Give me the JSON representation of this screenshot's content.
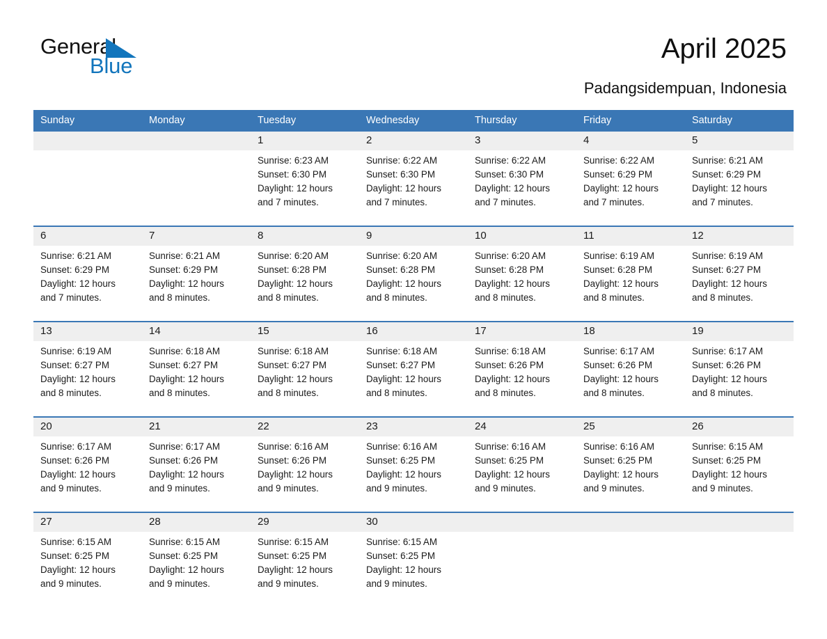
{
  "brand": {
    "name_part1": "General",
    "name_part2": "Blue",
    "accent_color": "#1275bc"
  },
  "header": {
    "title": "April 2025",
    "location": "Padangsidempuan, Indonesia"
  },
  "calendar": {
    "header_background": "#3a77b5",
    "daynum_background": "#efefef",
    "weekday_headers": [
      "Sunday",
      "Monday",
      "Tuesday",
      "Wednesday",
      "Thursday",
      "Friday",
      "Saturday"
    ],
    "weeks": [
      [
        {
          "day": "",
          "sunrise": "",
          "sunset": "",
          "daylight_line1": "",
          "daylight_line2": "",
          "empty": true
        },
        {
          "day": "",
          "sunrise": "",
          "sunset": "",
          "daylight_line1": "",
          "daylight_line2": "",
          "empty": true
        },
        {
          "day": "1",
          "sunrise": "Sunrise: 6:23 AM",
          "sunset": "Sunset: 6:30 PM",
          "daylight_line1": "Daylight: 12 hours",
          "daylight_line2": "and 7 minutes."
        },
        {
          "day": "2",
          "sunrise": "Sunrise: 6:22 AM",
          "sunset": "Sunset: 6:30 PM",
          "daylight_line1": "Daylight: 12 hours",
          "daylight_line2": "and 7 minutes."
        },
        {
          "day": "3",
          "sunrise": "Sunrise: 6:22 AM",
          "sunset": "Sunset: 6:30 PM",
          "daylight_line1": "Daylight: 12 hours",
          "daylight_line2": "and 7 minutes."
        },
        {
          "day": "4",
          "sunrise": "Sunrise: 6:22 AM",
          "sunset": "Sunset: 6:29 PM",
          "daylight_line1": "Daylight: 12 hours",
          "daylight_line2": "and 7 minutes."
        },
        {
          "day": "5",
          "sunrise": "Sunrise: 6:21 AM",
          "sunset": "Sunset: 6:29 PM",
          "daylight_line1": "Daylight: 12 hours",
          "daylight_line2": "and 7 minutes."
        }
      ],
      [
        {
          "day": "6",
          "sunrise": "Sunrise: 6:21 AM",
          "sunset": "Sunset: 6:29 PM",
          "daylight_line1": "Daylight: 12 hours",
          "daylight_line2": "and 7 minutes."
        },
        {
          "day": "7",
          "sunrise": "Sunrise: 6:21 AM",
          "sunset": "Sunset: 6:29 PM",
          "daylight_line1": "Daylight: 12 hours",
          "daylight_line2": "and 8 minutes."
        },
        {
          "day": "8",
          "sunrise": "Sunrise: 6:20 AM",
          "sunset": "Sunset: 6:28 PM",
          "daylight_line1": "Daylight: 12 hours",
          "daylight_line2": "and 8 minutes."
        },
        {
          "day": "9",
          "sunrise": "Sunrise: 6:20 AM",
          "sunset": "Sunset: 6:28 PM",
          "daylight_line1": "Daylight: 12 hours",
          "daylight_line2": "and 8 minutes."
        },
        {
          "day": "10",
          "sunrise": "Sunrise: 6:20 AM",
          "sunset": "Sunset: 6:28 PM",
          "daylight_line1": "Daylight: 12 hours",
          "daylight_line2": "and 8 minutes."
        },
        {
          "day": "11",
          "sunrise": "Sunrise: 6:19 AM",
          "sunset": "Sunset: 6:28 PM",
          "daylight_line1": "Daylight: 12 hours",
          "daylight_line2": "and 8 minutes."
        },
        {
          "day": "12",
          "sunrise": "Sunrise: 6:19 AM",
          "sunset": "Sunset: 6:27 PM",
          "daylight_line1": "Daylight: 12 hours",
          "daylight_line2": "and 8 minutes."
        }
      ],
      [
        {
          "day": "13",
          "sunrise": "Sunrise: 6:19 AM",
          "sunset": "Sunset: 6:27 PM",
          "daylight_line1": "Daylight: 12 hours",
          "daylight_line2": "and 8 minutes."
        },
        {
          "day": "14",
          "sunrise": "Sunrise: 6:18 AM",
          "sunset": "Sunset: 6:27 PM",
          "daylight_line1": "Daylight: 12 hours",
          "daylight_line2": "and 8 minutes."
        },
        {
          "day": "15",
          "sunrise": "Sunrise: 6:18 AM",
          "sunset": "Sunset: 6:27 PM",
          "daylight_line1": "Daylight: 12 hours",
          "daylight_line2": "and 8 minutes."
        },
        {
          "day": "16",
          "sunrise": "Sunrise: 6:18 AM",
          "sunset": "Sunset: 6:27 PM",
          "daylight_line1": "Daylight: 12 hours",
          "daylight_line2": "and 8 minutes."
        },
        {
          "day": "17",
          "sunrise": "Sunrise: 6:18 AM",
          "sunset": "Sunset: 6:26 PM",
          "daylight_line1": "Daylight: 12 hours",
          "daylight_line2": "and 8 minutes."
        },
        {
          "day": "18",
          "sunrise": "Sunrise: 6:17 AM",
          "sunset": "Sunset: 6:26 PM",
          "daylight_line1": "Daylight: 12 hours",
          "daylight_line2": "and 8 minutes."
        },
        {
          "day": "19",
          "sunrise": "Sunrise: 6:17 AM",
          "sunset": "Sunset: 6:26 PM",
          "daylight_line1": "Daylight: 12 hours",
          "daylight_line2": "and 8 minutes."
        }
      ],
      [
        {
          "day": "20",
          "sunrise": "Sunrise: 6:17 AM",
          "sunset": "Sunset: 6:26 PM",
          "daylight_line1": "Daylight: 12 hours",
          "daylight_line2": "and 9 minutes."
        },
        {
          "day": "21",
          "sunrise": "Sunrise: 6:17 AM",
          "sunset": "Sunset: 6:26 PM",
          "daylight_line1": "Daylight: 12 hours",
          "daylight_line2": "and 9 minutes."
        },
        {
          "day": "22",
          "sunrise": "Sunrise: 6:16 AM",
          "sunset": "Sunset: 6:26 PM",
          "daylight_line1": "Daylight: 12 hours",
          "daylight_line2": "and 9 minutes."
        },
        {
          "day": "23",
          "sunrise": "Sunrise: 6:16 AM",
          "sunset": "Sunset: 6:25 PM",
          "daylight_line1": "Daylight: 12 hours",
          "daylight_line2": "and 9 minutes."
        },
        {
          "day": "24",
          "sunrise": "Sunrise: 6:16 AM",
          "sunset": "Sunset: 6:25 PM",
          "daylight_line1": "Daylight: 12 hours",
          "daylight_line2": "and 9 minutes."
        },
        {
          "day": "25",
          "sunrise": "Sunrise: 6:16 AM",
          "sunset": "Sunset: 6:25 PM",
          "daylight_line1": "Daylight: 12 hours",
          "daylight_line2": "and 9 minutes."
        },
        {
          "day": "26",
          "sunrise": "Sunrise: 6:15 AM",
          "sunset": "Sunset: 6:25 PM",
          "daylight_line1": "Daylight: 12 hours",
          "daylight_line2": "and 9 minutes."
        }
      ],
      [
        {
          "day": "27",
          "sunrise": "Sunrise: 6:15 AM",
          "sunset": "Sunset: 6:25 PM",
          "daylight_line1": "Daylight: 12 hours",
          "daylight_line2": "and 9 minutes."
        },
        {
          "day": "28",
          "sunrise": "Sunrise: 6:15 AM",
          "sunset": "Sunset: 6:25 PM",
          "daylight_line1": "Daylight: 12 hours",
          "daylight_line2": "and 9 minutes."
        },
        {
          "day": "29",
          "sunrise": "Sunrise: 6:15 AM",
          "sunset": "Sunset: 6:25 PM",
          "daylight_line1": "Daylight: 12 hours",
          "daylight_line2": "and 9 minutes."
        },
        {
          "day": "30",
          "sunrise": "Sunrise: 6:15 AM",
          "sunset": "Sunset: 6:25 PM",
          "daylight_line1": "Daylight: 12 hours",
          "daylight_line2": "and 9 minutes."
        },
        {
          "day": "",
          "sunrise": "",
          "sunset": "",
          "daylight_line1": "",
          "daylight_line2": "",
          "empty": true
        },
        {
          "day": "",
          "sunrise": "",
          "sunset": "",
          "daylight_line1": "",
          "daylight_line2": "",
          "empty": true
        },
        {
          "day": "",
          "sunrise": "",
          "sunset": "",
          "daylight_line1": "",
          "daylight_line2": "",
          "empty": true
        }
      ]
    ]
  }
}
